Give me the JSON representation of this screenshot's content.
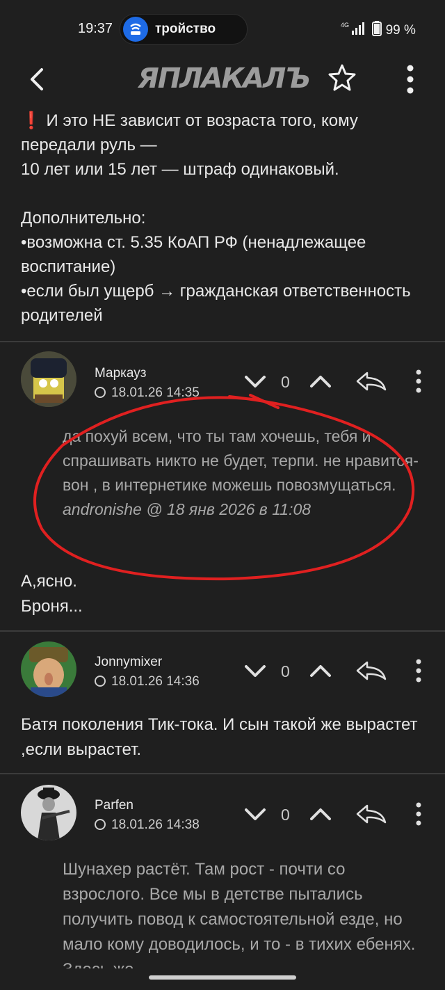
{
  "status_bar": {
    "time": "19:37",
    "pill_text": "тройство",
    "signal": "4G",
    "battery": "99 %"
  },
  "app": {
    "logo": "ЯПЛАКАЛЪ"
  },
  "post_text": "❗ И это НЕ зависит от возраста того, кому передали руль —\n10 лет или 15 лет — штраф одинаковый.\n\nДополнительно:\n  •возможна ст. 5.35 КоАП РФ (ненадлежащее воспитание)\n  •если был ущерб → гражданская ответственность родителей",
  "comments": [
    {
      "username": "Маркауз",
      "date": "18.01.26 14:35",
      "score": "0",
      "quote_text": "да похуй всем, что ты там хочешь, тебя и спрашивать никто не будет, терпи. не нравится- вон , в интернетике можешь повозмущаться.",
      "quote_author": "andronishe @ 18 янв 2026 в 11:08",
      "text_lines": [
        "А,ясно.",
        "Броня..."
      ]
    },
    {
      "username": "Jonnymixer",
      "date": "18.01.26 14:36",
      "score": "0",
      "text": "Батя поколения Тик-тока. И сын такой же вырастет ,если вырастет."
    },
    {
      "username": "Parfen",
      "date": "18.01.26 14:38",
      "score": "0",
      "quote_text": "Шунахер растёт. Там рост - почти со взрослого. Все мы в детстве пытались получить повод к самостоятельной езде, но мало кому доводилось, и то - в тихих ебенях. Здесь же -"
    }
  ],
  "colors": {
    "background": "#1f1f1f",
    "annotation_circle": "#e02020",
    "pill_icon": "#1e6be6"
  }
}
